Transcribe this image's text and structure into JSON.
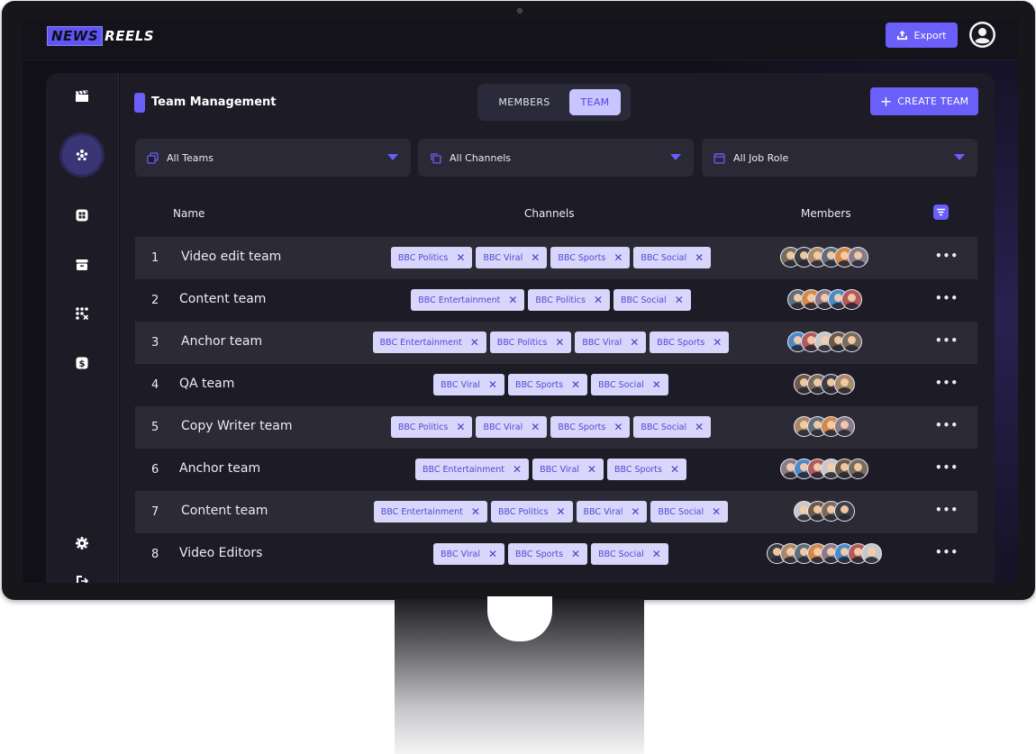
{
  "app": {
    "logo_news": "NEWS",
    "logo_reels": "REELS"
  },
  "topbar": {
    "export_label": "Export"
  },
  "page": {
    "title": "Team Management"
  },
  "toggle": {
    "members": "MEMBERS",
    "team": "TEAM",
    "selected": "TEAM"
  },
  "actions": {
    "create_team": "CREATE TEAM"
  },
  "filters": {
    "teams": "All Teams",
    "channels": "All Channels",
    "job_role": "All Job Role"
  },
  "table": {
    "headers": {
      "name": "Name",
      "channels": "Channels",
      "members": "Members"
    },
    "rows": [
      {
        "num": "1",
        "name": "Video edit team",
        "channels": [
          "BBC Politics",
          "BBC Viral",
          "BBC Sports",
          "BBC Social"
        ],
        "members": 6
      },
      {
        "num": "2",
        "name": "Content team",
        "channels": [
          "BBC Entertainment",
          "BBC Politics",
          "BBC Social"
        ],
        "members": 5
      },
      {
        "num": "3",
        "name": "Anchor team",
        "channels": [
          "BBC Entertainment",
          "BBC Politics",
          "BBC Viral",
          "BBC Sports"
        ],
        "members": 5
      },
      {
        "num": "4",
        "name": "QA team",
        "channels": [
          "BBC Viral",
          "BBC Sports",
          "BBC Social"
        ],
        "members": 4
      },
      {
        "num": "5",
        "name": "Copy Writer team",
        "channels": [
          "BBC Politics",
          "BBC Viral",
          "BBC Sports",
          "BBC Social"
        ],
        "members": 4
      },
      {
        "num": "6",
        "name": "Anchor team",
        "channels": [
          "BBC Entertainment",
          "BBC Viral",
          "BBC Sports"
        ],
        "members": 6
      },
      {
        "num": "7",
        "name": "Content team",
        "channels": [
          "BBC Entertainment",
          "BBC Politics",
          "BBC Viral",
          "BBC Social"
        ],
        "members": 4
      },
      {
        "num": "8",
        "name": "Video Editors",
        "channels": [
          "BBC Viral",
          "BBC Sports",
          "BBC Social"
        ],
        "members": 8
      }
    ]
  },
  "icons": {
    "sidebar": [
      "clapperboard-icon",
      "team-icon",
      "grid-icon",
      "archive-icon",
      "apps-icon",
      "dollar-icon",
      "settings-icon",
      "logout-icon"
    ],
    "topbar": [
      "upload-icon",
      "user-profile-icon"
    ]
  },
  "colors": {
    "accent": "#6a5ff8",
    "chip_bg": "#d9d6fb",
    "chip_text": "#5349d6",
    "background": "#1d1c26"
  }
}
